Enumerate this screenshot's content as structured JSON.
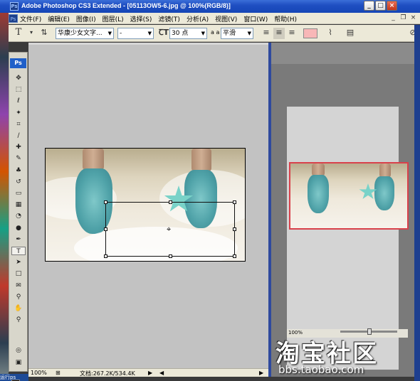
{
  "window": {
    "title": "Adobe Photoshop CS3 Extended - [05113OW5-6.jpg @ 100%(RGB/8)]",
    "app_icon": "Ps",
    "buttons": {
      "minimize": "_",
      "restore": "□",
      "close": "×"
    }
  },
  "menu": {
    "items": [
      "文件(F)",
      "编辑(E)",
      "图像(I)",
      "图层(L)",
      "选择(S)",
      "滤镜(T)",
      "分析(A)",
      "视图(V)",
      "窗口(W)",
      "帮助(H)"
    ],
    "doc_controls": {
      "minimize": "_",
      "restore": "❐",
      "close": "×"
    }
  },
  "options_bar": {
    "tool_icon": "T",
    "font_family": "华康少女文字...",
    "font_style": "-",
    "font_size": "30 点",
    "aa_label": "a a",
    "antialias": "平滑",
    "text_color": "#f8b7b7"
  },
  "toolbox": {
    "logo": "Ps",
    "tools": [
      {
        "name": "move-tool",
        "glyph": "✥"
      },
      {
        "name": "marquee-tool",
        "glyph": "⬚"
      },
      {
        "name": "lasso-tool",
        "glyph": "ℓ"
      },
      {
        "name": "magic-wand-tool",
        "glyph": "✦"
      },
      {
        "name": "crop-tool",
        "glyph": "⌗"
      },
      {
        "name": "slice-tool",
        "glyph": "∕"
      },
      {
        "name": "healing-brush-tool",
        "glyph": "✚"
      },
      {
        "name": "brush-tool",
        "glyph": "✎"
      },
      {
        "name": "clone-stamp-tool",
        "glyph": "♣"
      },
      {
        "name": "history-brush-tool",
        "glyph": "↺"
      },
      {
        "name": "eraser-tool",
        "glyph": "▭"
      },
      {
        "name": "gradient-tool",
        "glyph": "▦"
      },
      {
        "name": "blur-tool",
        "glyph": "◔"
      },
      {
        "name": "dodge-tool",
        "glyph": "●"
      },
      {
        "name": "pen-tool",
        "glyph": "✒"
      },
      {
        "name": "type-tool",
        "glyph": "T"
      },
      {
        "name": "path-selection-tool",
        "glyph": "➤"
      },
      {
        "name": "shape-tool",
        "glyph": "□"
      },
      {
        "name": "notes-tool",
        "glyph": "✉"
      },
      {
        "name": "eyedropper-tool",
        "glyph": "⚲"
      },
      {
        "name": "hand-tool",
        "glyph": "✋"
      },
      {
        "name": "zoom-tool",
        "glyph": "⚲"
      }
    ],
    "active_tool": "type-tool",
    "quickmask_glyph": "◎",
    "screenmode_glyph": "▣"
  },
  "status_bar": {
    "zoom": "100%",
    "doc_info": "文档:267.2K/534.4K"
  },
  "navigator": {
    "zoom": "100%"
  },
  "watermark": {
    "main": "淘宝社区",
    "url": "bbs.taobao.com"
  },
  "desktop": {
    "corner_text": "运行ps"
  }
}
